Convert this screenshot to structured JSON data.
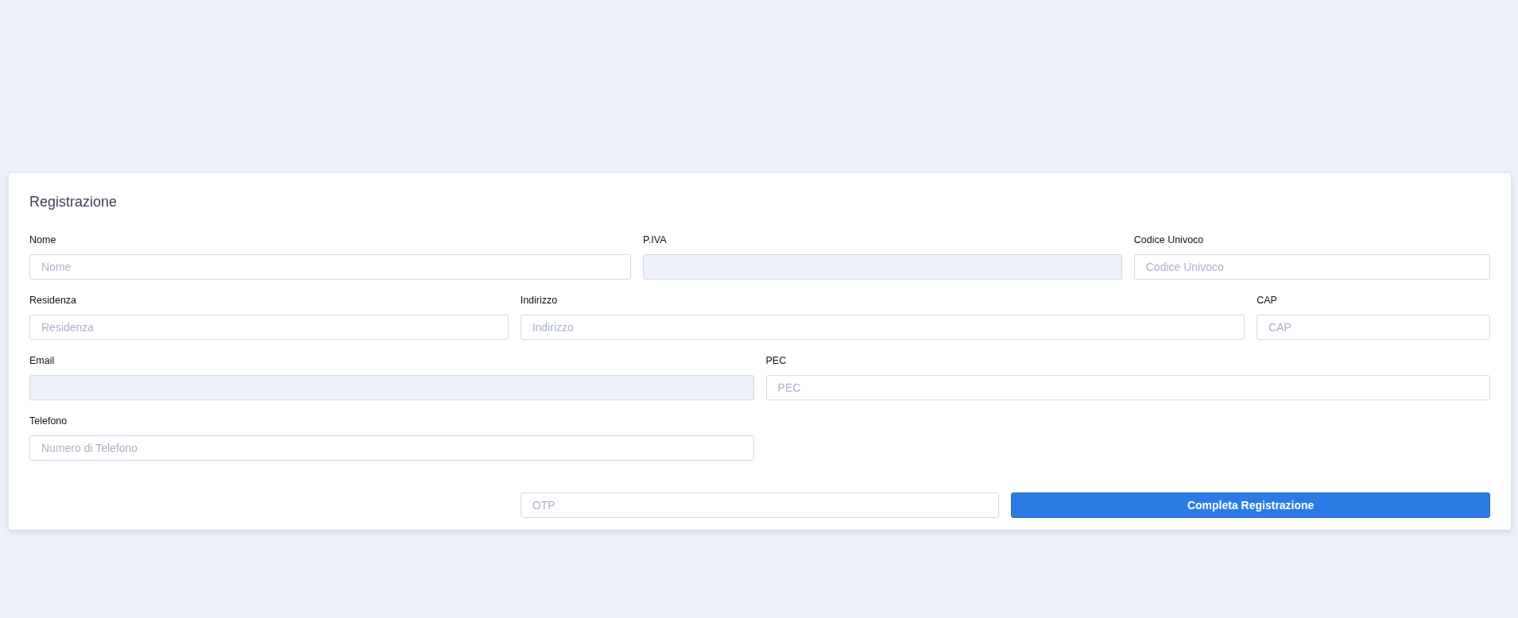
{
  "card": {
    "title": "Registrazione"
  },
  "rows": [
    [
      {
        "label": "Nome",
        "placeholder": "Nome",
        "disabled": false
      },
      {
        "label": "P.IVA",
        "disabled": true
      },
      {
        "label": "Codice Univoco",
        "placeholder": "Codice Univoco",
        "disabled": false
      }
    ],
    [
      {
        "label": "Residenza",
        "placeholder": "Residenza",
        "disabled": false
      },
      {
        "label": "Indirizzo",
        "placeholder": "Indirizzo",
        "disabled": false
      },
      {
        "label": "CAP",
        "placeholder": "CAP",
        "disabled": false
      }
    ],
    [
      {
        "label": "Email",
        "disabled": true
      },
      {
        "label": "PEC",
        "placeholder": "PEC",
        "disabled": false
      }
    ],
    [
      {
        "label": "Telefono",
        "placeholder": "Numero di Telefono",
        "disabled": false
      }
    ]
  ],
  "otp": {
    "placeholder": "OTP"
  },
  "submit_button": "Completa Registrazione"
}
